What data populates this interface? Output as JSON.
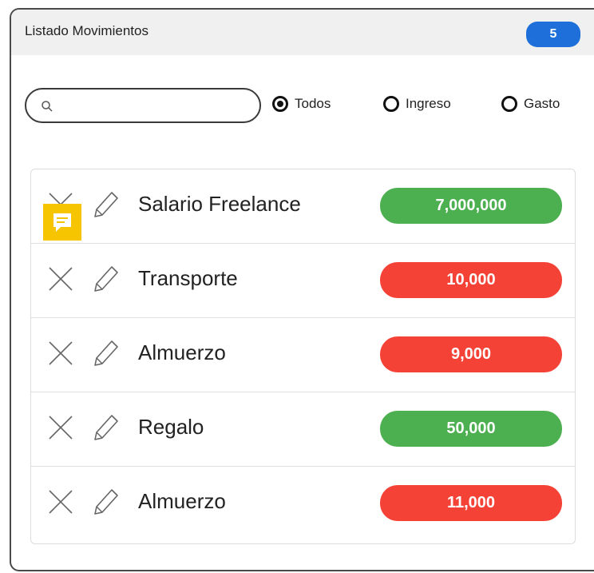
{
  "header": {
    "title": "Listado Movimientos",
    "count": "5"
  },
  "search": {
    "value": "",
    "placeholder": ""
  },
  "filters": [
    {
      "label": "Todos",
      "checked": true
    },
    {
      "label": "Ingreso",
      "checked": false
    },
    {
      "label": "Gasto",
      "checked": false
    }
  ],
  "movements": [
    {
      "name": "Salario Freelance",
      "amount": "7,000,000",
      "type": "ingreso",
      "color": "#4caf50"
    },
    {
      "name": "Transporte",
      "amount": "10,000",
      "type": "gasto",
      "color": "#f44336"
    },
    {
      "name": "Almuerzo",
      "amount": "9,000",
      "type": "gasto",
      "color": "#f44336"
    },
    {
      "name": "Regalo",
      "amount": "50,000",
      "type": "ingreso",
      "color": "#4caf50"
    },
    {
      "name": "Almuerzo",
      "amount": "11,000",
      "type": "gasto",
      "color": "#f44336"
    }
  ],
  "icons": {
    "search": "search-icon",
    "delete": "close-icon",
    "edit": "pencil-icon",
    "comment": "comment-icon"
  },
  "colors": {
    "badge": "#1e6fd9",
    "ingreso": "#4caf50",
    "gasto": "#f44336",
    "comment": "#f6c500"
  }
}
